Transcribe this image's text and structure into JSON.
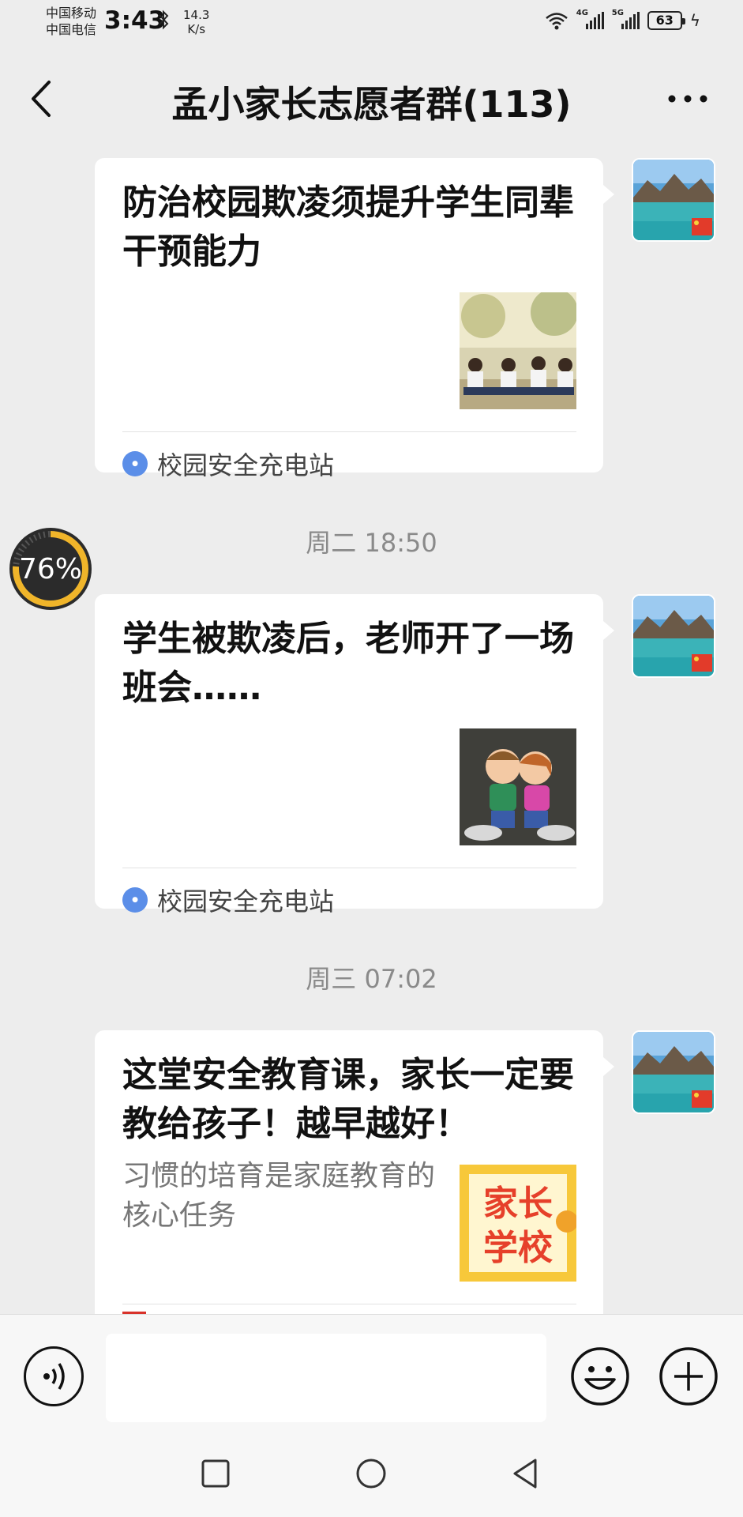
{
  "status_bar": {
    "carrier_1": "中国移动",
    "carrier_2": "中国电信",
    "time": "3:43",
    "net_speed_value": "14.3",
    "net_speed_unit": "K/s",
    "signal_1_tag": "4G",
    "signal_2_tag": "5G",
    "battery": "63"
  },
  "header": {
    "title": "孟小家长志愿者群(113)"
  },
  "messages": [
    {
      "title": "防治校园欺凌须提升学生同辈干预能力",
      "description": "",
      "source": "校园安全充电站"
    },
    {
      "timestamp": "周二 18:50",
      "title": "学生被欺凌后，老师开了一场班会……",
      "description": "",
      "source": "校园安全充电站"
    },
    {
      "timestamp": "周三 07:02",
      "title": "这堂安全教育课，家长一定要教给孩子！越早越好！",
      "description": "习惯的培育是家庭教育的核心任务",
      "thumb_text_1": "家长",
      "thumb_text_2": "学校"
    }
  ],
  "overlay": {
    "progress_label": "76%",
    "progress_value": 0.76
  },
  "input": {
    "value": ""
  },
  "colors": {
    "background": "#ededed",
    "card": "#ffffff",
    "source_icon": "#5b8ee8",
    "badge_ring": "#f0b52a"
  }
}
